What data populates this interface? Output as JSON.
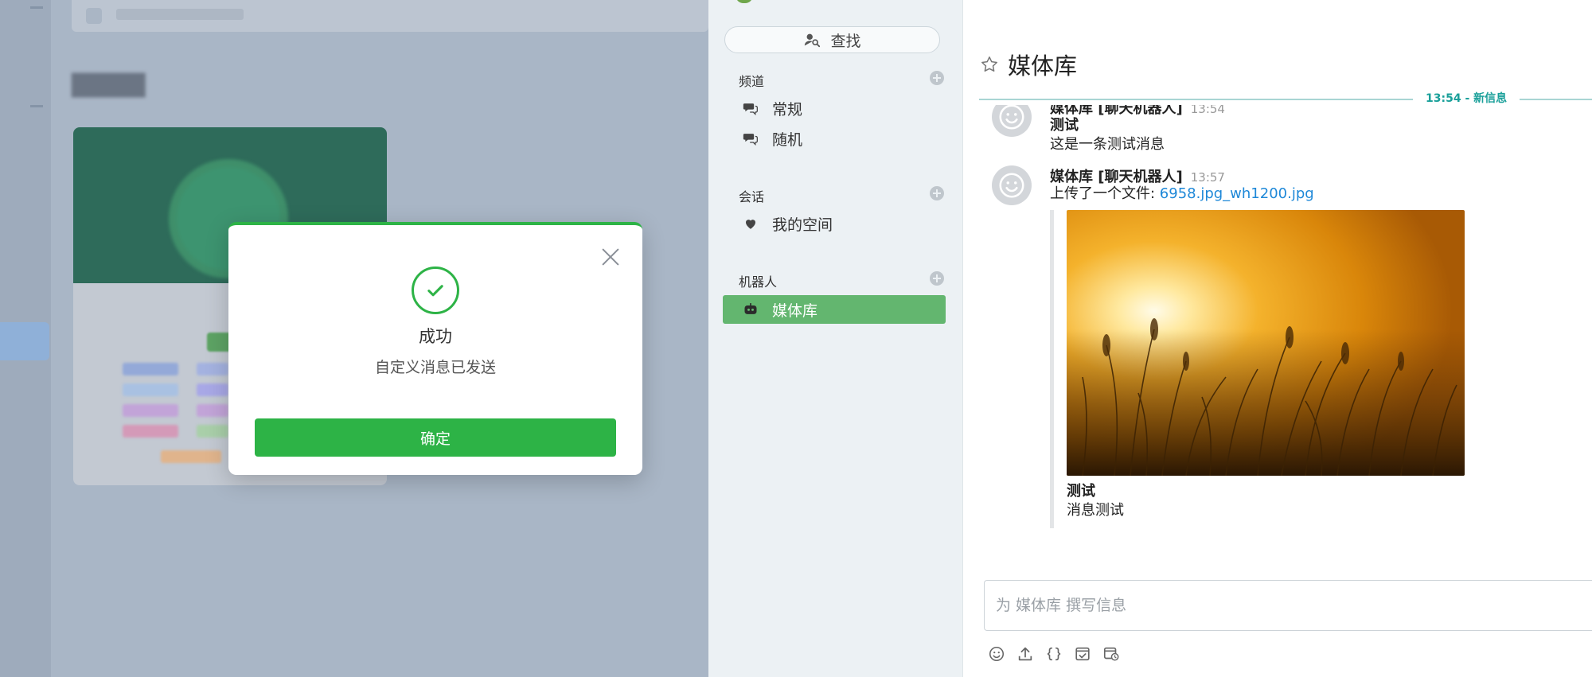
{
  "modal": {
    "title": "成功",
    "message": "自定义消息已发送",
    "confirm_label": "确定"
  },
  "sidebar": {
    "search_label": "查找",
    "sections": [
      {
        "title": "频道",
        "items": [
          {
            "label": "常规",
            "icon": "chat-bubbles-icon"
          },
          {
            "label": "随机",
            "icon": "chat-bubbles-icon"
          }
        ]
      },
      {
        "title": "会话",
        "items": [
          {
            "label": "我的空间",
            "icon": "heart-icon"
          }
        ]
      },
      {
        "title": "机器人",
        "items": [
          {
            "label": "媒体库",
            "icon": "robot-icon",
            "active": true
          }
        ]
      }
    ]
  },
  "room": {
    "title": "媒体库",
    "new_messages_divider": "13:54 - 新信息"
  },
  "messages": [
    {
      "author": "媒体库 [聊天机器人]",
      "time": "13:54",
      "strong": "测试",
      "text": "这是一条测试消息"
    },
    {
      "author": "媒体库 [聊天机器人]",
      "time": "13:57",
      "text_prefix": "上传了一个文件: ",
      "file_link": "6958.jpg_wh1200.jpg",
      "attachment_title": "测试",
      "attachment_desc": "消息测试"
    }
  ],
  "composer": {
    "placeholder": "为 媒体库 撰写信息"
  },
  "colors": {
    "accent_green": "#2db346",
    "active_item": "#63b66f",
    "link_blue": "#1e88d8",
    "divider_teal": "#1aa09a"
  }
}
